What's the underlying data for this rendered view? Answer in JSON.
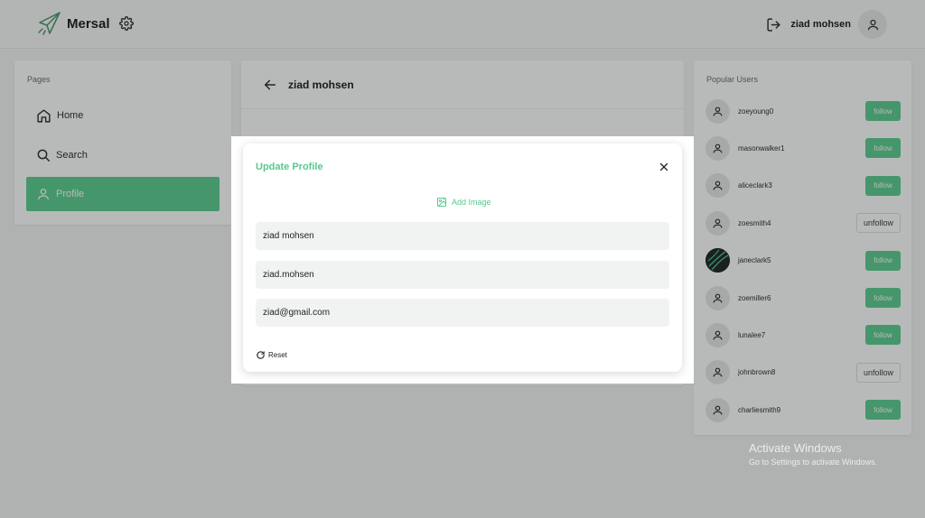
{
  "app": {
    "brand_name": "Mersal"
  },
  "header": {
    "user_name": "ziad mohsen"
  },
  "sidebar": {
    "label": "Pages",
    "items": [
      {
        "label": "Home",
        "icon": "home-icon"
      },
      {
        "label": "Search",
        "icon": "search-icon"
      },
      {
        "label": "Profile",
        "icon": "user-icon",
        "active": true
      }
    ]
  },
  "center": {
    "title": "ziad mohsen"
  },
  "popular": {
    "label": "Popular Users",
    "users": [
      {
        "name": "zoeyoung0",
        "action": "follow"
      },
      {
        "name": "masonwalker1",
        "action": "follow"
      },
      {
        "name": "aliceclark3",
        "action": "follow"
      },
      {
        "name": "zoesmith4",
        "action": "unfollow"
      },
      {
        "name": "janeclark5",
        "action": "follow"
      },
      {
        "name": "zoemiller6",
        "action": "follow"
      },
      {
        "name": "lunalee7",
        "action": "follow"
      },
      {
        "name": "johnbrown8",
        "action": "unfollow"
      },
      {
        "name": "charliesmith9",
        "action": "follow"
      }
    ]
  },
  "modal": {
    "title": "Update Profile",
    "add_image": "Add Image",
    "fields": {
      "name": "ziad mohsen",
      "username": "ziad.mohsen",
      "email": "ziad@gmail.com"
    },
    "reset": "Reset"
  },
  "watermark": {
    "title": "Activate Windows",
    "subtitle": "Go to Settings to activate Windows."
  },
  "colors": {
    "accent": "#56c98d",
    "overlay": "rgba(40,45,43,0.33)"
  }
}
